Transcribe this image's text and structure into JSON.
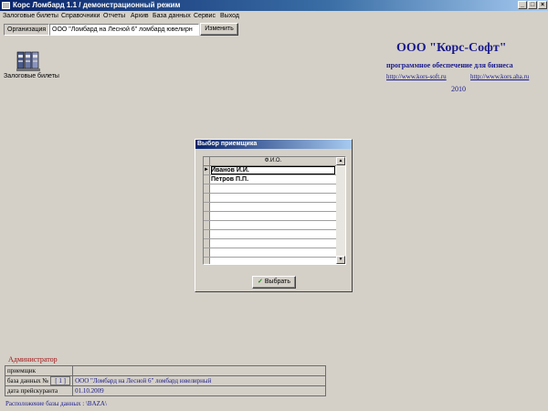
{
  "window": {
    "title": "Корс Ломбард 1.1 / демонстрационный режим"
  },
  "menu": [
    "Залоговые билеты",
    "Справочники",
    "Отчеты",
    "Архив",
    "База данных",
    "Сервис",
    "Выход"
  ],
  "org": {
    "label": "Организация",
    "value": "ООО \"Ломбард на Лесной 6\" ломбард ювелирн",
    "button": "Изменить"
  },
  "desktop_icon": {
    "label": "Залоговые билеты"
  },
  "company": {
    "name": "ООО \"Корс-Софт\"",
    "subtitle": "программное обеспечение для бизнеса",
    "link1": "http://www.kors-soft.ru",
    "link2": "http://www.kors.aha.ru",
    "year": "2010"
  },
  "dialog": {
    "title": "Выбор приемщика",
    "column": "Ф.И.О.",
    "rows": [
      "Иванов И.И.",
      "Петров П.П."
    ],
    "button": "Выбрать"
  },
  "info": {
    "user": "Администратор",
    "receiver_label": "приемщик",
    "receiver_value": "",
    "db_label": "база данных №",
    "db_number": "[ 1 ]",
    "db_value": "ООО \"Ломбард на Лесной 6\" ломбард ювелирный",
    "price_label": "дата прейскуранта",
    "price_value": "01.10.2009",
    "location": "Расположение базы данных : \\BAZA\\"
  }
}
